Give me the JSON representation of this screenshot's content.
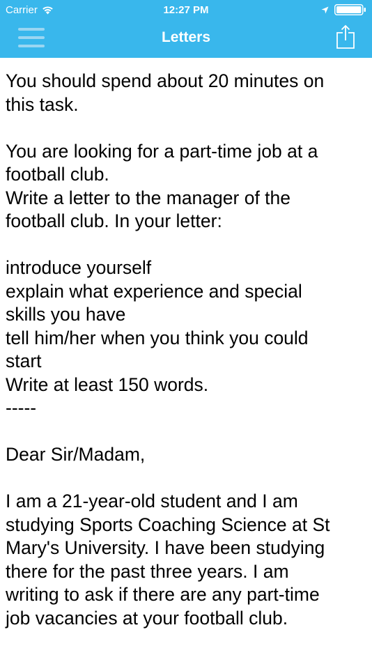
{
  "status_bar": {
    "carrier": "Carrier",
    "time": "12:27 PM"
  },
  "nav": {
    "title": "Letters"
  },
  "content": {
    "lines": [
      "You should spend about 20 minutes on",
      "this task.",
      "",
      "You are looking for a part-time job at a",
      "football club.",
      "Write a letter to the manager of the",
      "football club. In your letter:",
      "",
      "introduce yourself",
      "explain what experience and special",
      "skills you have",
      "tell him/her when you think you could",
      "start",
      "Write at least 150 words.",
      "-----",
      "",
      "Dear Sir/Madam,",
      "",
      "I am a 21-year-old student and I am",
      "studying Sports Coaching Science at St",
      "Mary's University. I have been studying",
      "there for the past three years. I am",
      "writing to ask if there are any part-time",
      "job vacancies at your football club."
    ]
  },
  "colors": {
    "header_background": "#39b7ec",
    "header_text": "#ffffff",
    "body_text": "#000000"
  }
}
